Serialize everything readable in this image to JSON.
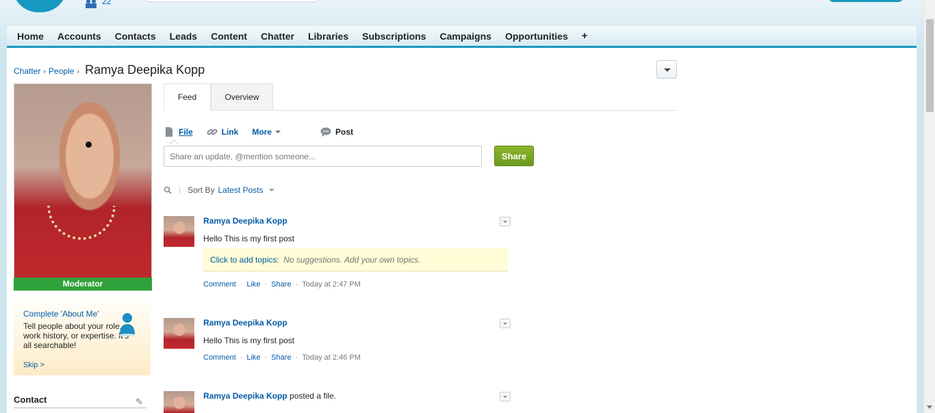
{
  "header": {
    "user_count": "22"
  },
  "nav": {
    "tabs": [
      "Home",
      "Accounts",
      "Contacts",
      "Leads",
      "Content",
      "Chatter",
      "Libraries",
      "Subscriptions",
      "Campaigns",
      "Opportunities"
    ],
    "plus": "+"
  },
  "breadcrumb": {
    "chatter": "Chatter",
    "people": "People",
    "sep": "›",
    "name": "Ramya Deepika Kopp"
  },
  "profile": {
    "badge": "Moderator",
    "about": {
      "title": "Complete 'About Me'",
      "desc": "Tell people about your role, work history, or expertise. It's all searchable!",
      "skip": "Skip >"
    },
    "contact_header": "Contact"
  },
  "feed": {
    "tabs": {
      "feed": "Feed",
      "overview": "Overview"
    },
    "publisher": {
      "post": "Post",
      "file": "File",
      "link": "Link",
      "more": "More"
    },
    "share_placeholder": "Share an update, @mention someone...",
    "share_button": "Share",
    "sort_label": "Sort By",
    "sort_value": "Latest Posts",
    "posts": [
      {
        "author": "Ramya Deepika Kopp",
        "body": "Hello This is my first post",
        "topics_label": "Click to add topics:",
        "topics_hint": "No suggestions. Add your own topics.",
        "comment": "Comment",
        "like": "Like",
        "share": "Share",
        "time": "Today at 2:47 PM"
      },
      {
        "author": "Ramya Deepika Kopp",
        "body": "Hello This is my first post",
        "comment": "Comment",
        "like": "Like",
        "share": "Share",
        "time": "Today at 2:46 PM"
      },
      {
        "author": "Ramya Deepika Kopp",
        "extra": " posted a file."
      }
    ],
    "dot": "·"
  },
  "colors": {
    "brand": "#1798c1",
    "link": "#015ba7",
    "share_green": "#7aa823",
    "moderator_green": "#2fa13a"
  }
}
